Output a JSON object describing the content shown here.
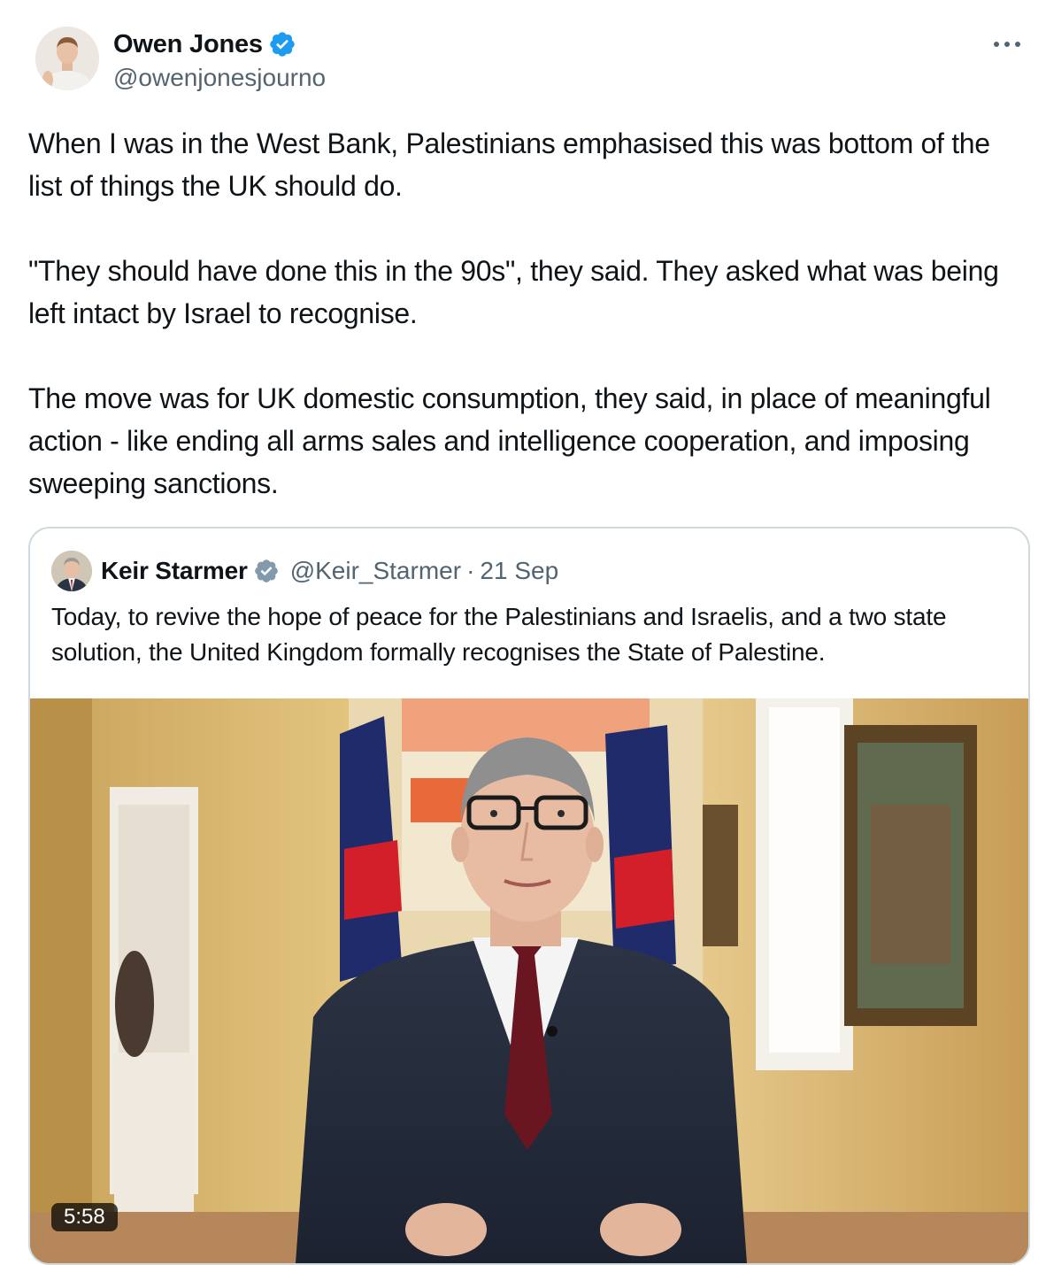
{
  "tweet": {
    "author": {
      "name": "Owen Jones",
      "handle": "@owenjonesjourno"
    },
    "more_label": "•••",
    "paragraphs": [
      "When I was in the West Bank, Palestinians emphasised this was bottom of the list of things the UK should do.",
      "\"They should have done this in the 90s\", they said. They asked what was being left intact by Israel to recognise.",
      "The move was for UK domestic consumption, they said, in place of meaningful action - like ending all arms sales and intelligence cooperation, and imposing sweeping sanctions."
    ]
  },
  "quote": {
    "author": {
      "name": "Keir Starmer",
      "handle": "@Keir_Starmer"
    },
    "separator": "·",
    "date": "21 Sep",
    "text": "Today, to revive the hope of peace for the Palestinians and Israelis, and a two state solution, the United Kingdom formally recognises the State of Palestine.",
    "video": {
      "duration": "5:58"
    }
  },
  "colors": {
    "text": "#0f1419",
    "secondary": "#536471",
    "verified_blue": "#1d9bf0",
    "verified_grey": "#829aab",
    "border": "#cfd9de"
  }
}
